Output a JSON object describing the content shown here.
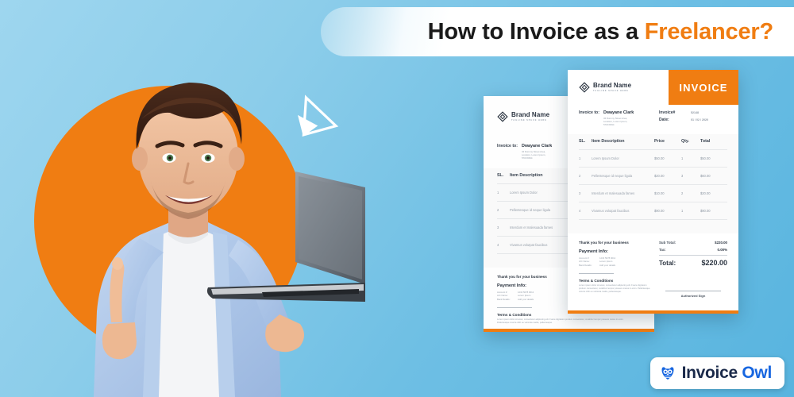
{
  "banner": {
    "title_main": "How to Invoice as a ",
    "title_accent": "Freelancer?",
    "accent_color": "#f07d12"
  },
  "colors": {
    "background_blue_light": "#9ed6ef",
    "background_blue_dark": "#58b4df",
    "orange": "#f07d12",
    "logo_blue": "#1766e0",
    "logo_navy": "#1b2a4a"
  },
  "hero": {
    "subject": "smiling man holding laptop pointing up",
    "shapes": [
      "orange-circle",
      "white-triangle"
    ]
  },
  "invoice": {
    "badge_label": "INVOICE",
    "brand": {
      "name": "Brand Name",
      "tagline": "TAGLINE SPACE HERE",
      "logo_icon": "diamond-logo-icon"
    },
    "billto": {
      "label": "Invoice to:",
      "name": "Dwayane Clark",
      "address_lines": [
        "34 Dummy Street Area,",
        "Location, Lorem Ipsum,",
        "570XX694"
      ]
    },
    "meta": [
      {
        "key": "Invoice#",
        "value": "52148"
      },
      {
        "key": "Date:",
        "value": "01 / 02 / 2020"
      }
    ],
    "table": {
      "headers": [
        "SL.",
        "Item Description",
        "Price",
        "Qty.",
        "Total"
      ],
      "rows": [
        {
          "sl": "1",
          "desc": "Lorem Ipsum Dolor",
          "price": "$50.00",
          "qty": "1",
          "total": "$50.00"
        },
        {
          "sl": "2",
          "desc": "Pellentesque id neque ligula",
          "price": "$20.00",
          "qty": "3",
          "total": "$60.00"
        },
        {
          "sl": "3",
          "desc": "Interdum et malesuada fames",
          "price": "$10.00",
          "qty": "2",
          "total": "$20.00"
        },
        {
          "sl": "4",
          "desc": "Vivamus volutpat faucibus",
          "price": "$90.00",
          "qty": "1",
          "total": "$90.00"
        }
      ]
    },
    "footer": {
      "thanks": "Thank you for your business",
      "payment_title": "Payment Info:",
      "payment_rows": [
        {
          "key": "Account #:",
          "value": "1234 5678 9012"
        },
        {
          "key": "A/C Name:",
          "value": "Lorem Ipsum"
        },
        {
          "key": "Bank Details:",
          "value": "Add your details"
        }
      ],
      "terms_title": "Terms & Conditions",
      "terms_body": "Lorem ipsum dolor sit amet, consectetur adipiscing elit. Fusce dignissim pretium consectetur, curabitur tempor posuere metus in enim. Pellentesque viverra nibh eu vehicula mattis, pellentesque.",
      "sub_total_label": "Sub Total:",
      "sub_total_value": "$220.00",
      "tax_label": "Tax:",
      "tax_value": "0.00%",
      "total_label": "Total:",
      "total_value": "$220.00",
      "sign_label": "Authorized Sign"
    }
  },
  "logo": {
    "word_one": "Invoice",
    "word_two": "Owl",
    "icon": "owl-icon"
  }
}
